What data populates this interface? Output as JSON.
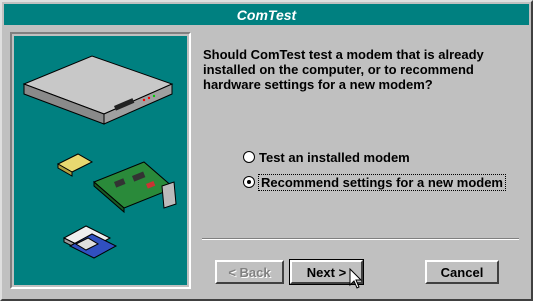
{
  "window": {
    "title": "ComTest"
  },
  "question": "Should ComTest test a modem that is already installed on the computer, or to recommend hardware settings for a new modem?",
  "options": [
    {
      "label": "Test an installed modem",
      "selected": false
    },
    {
      "label": "Recommend settings for a new modem",
      "selected": true
    }
  ],
  "buttons": {
    "back": "< Back",
    "next": "Next >",
    "cancel": "Cancel"
  },
  "colors": {
    "panel_bg": "#008080",
    "face": "#c0c0c0",
    "title_bg": "#008080"
  },
  "illustrations": [
    "external-modem-icon",
    "modem-card-icon",
    "floppy-disk-icon"
  ]
}
